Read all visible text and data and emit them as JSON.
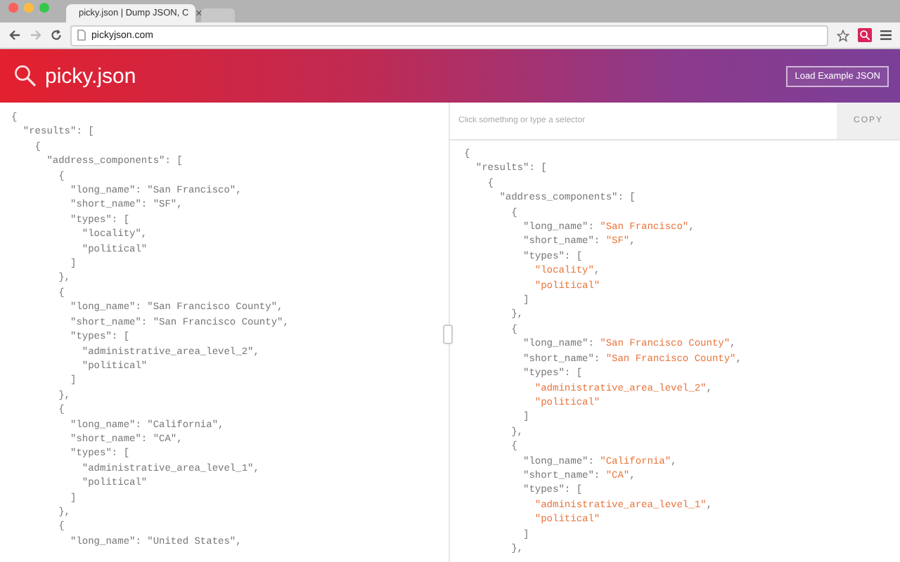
{
  "browser": {
    "tabs": [
      {
        "title": "picky.json | Dump JSON, C",
        "selected": true
      }
    ],
    "address": "pickyjson.com",
    "close_glyph": "×"
  },
  "header": {
    "title": "picky.json",
    "button": "Load Example JSON"
  },
  "raw_json": {
    "lines": [
      "{",
      "  \"results\": [",
      "    {",
      "      \"address_components\": [",
      "        {",
      "          \"long_name\": \"San Francisco\",",
      "          \"short_name\": \"SF\",",
      "          \"types\": [",
      "            \"locality\",",
      "            \"political\"",
      "          ]",
      "        },",
      "        {",
      "          \"long_name\": \"San Francisco County\",",
      "          \"short_name\": \"San Francisco County\",",
      "          \"types\": [",
      "            \"administrative_area_level_2\",",
      "            \"political\"",
      "          ]",
      "        },",
      "        {",
      "          \"long_name\": \"California\",",
      "          \"short_name\": \"CA\",",
      "          \"types\": [",
      "            \"administrative_area_level_1\",",
      "            \"political\"",
      "          ]",
      "        },",
      "        {",
      "          \"long_name\": \"United States\","
    ]
  },
  "selector": {
    "placeholder": "Click something or type a selector",
    "button": "COPY"
  },
  "formatted_json": {
    "lines": [
      {
        "key": "{"
      },
      {
        "key": "  \"results\": ["
      },
      {
        "key": "    {"
      },
      {
        "key": "      \"address_components\": ["
      },
      {
        "key": "        {"
      },
      {
        "key": "          \"long_name\": ",
        "value": "\"San Francisco\"",
        "tail": ","
      },
      {
        "key": "          \"short_name\": ",
        "value": "\"SF\"",
        "tail": ","
      },
      {
        "key": "          \"types\": ["
      },
      {
        "value": "            \"locality\"",
        "tail": ","
      },
      {
        "value": "            \"political\""
      },
      {
        "key": "          ]"
      },
      {
        "key": "        },"
      },
      {
        "key": "        {"
      },
      {
        "key": "          \"long_name\": ",
        "value": "\"San Francisco County\"",
        "tail": ","
      },
      {
        "key": "          \"short_name\": ",
        "value": "\"San Francisco County\"",
        "tail": ","
      },
      {
        "key": "          \"types\": ["
      },
      {
        "value": "            \"administrative_area_level_2\"",
        "tail": ","
      },
      {
        "value": "            \"political\""
      },
      {
        "key": "          ]"
      },
      {
        "key": "        },"
      },
      {
        "key": "        {"
      },
      {
        "key": "          \"long_name\": ",
        "value": "\"California\"",
        "tail": ","
      },
      {
        "key": "          \"short_name\": ",
        "value": "\"CA\"",
        "tail": ","
      },
      {
        "key": "          \"types\": ["
      },
      {
        "value": "            \"administrative_area_level_1\"",
        "tail": ","
      },
      {
        "value": "            \"political\""
      },
      {
        "key": "          ]"
      },
      {
        "key": "        },"
      }
    ]
  }
}
